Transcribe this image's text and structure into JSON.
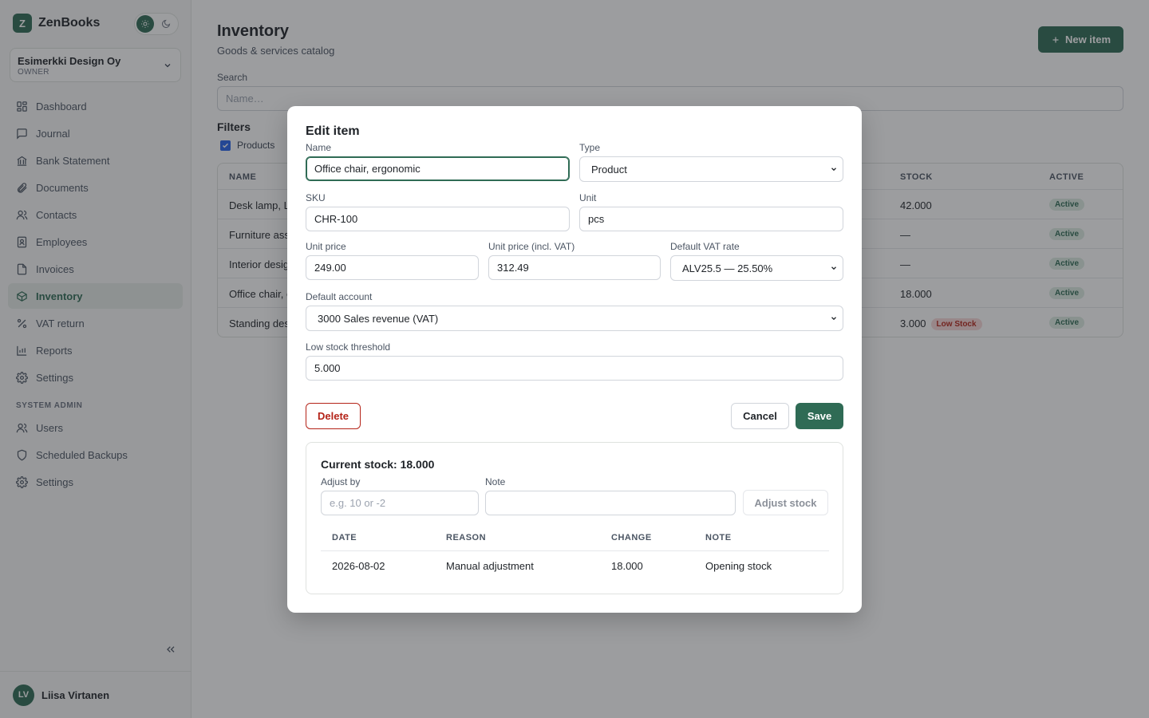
{
  "app": {
    "name": "ZenBooks",
    "logo_letter": "Z"
  },
  "org": {
    "name": "Esimerkki Design Oy",
    "role": "OWNER"
  },
  "nav": {
    "items": [
      {
        "label": "Dashboard",
        "icon": "dashboard-icon",
        "active": false
      },
      {
        "label": "Journal",
        "icon": "journal-icon",
        "active": false
      },
      {
        "label": "Bank Statement",
        "icon": "bank-icon",
        "active": false
      },
      {
        "label": "Documents",
        "icon": "paperclip-icon",
        "active": false
      },
      {
        "label": "Contacts",
        "icon": "contacts-icon",
        "active": false
      },
      {
        "label": "Employees",
        "icon": "employee-badge-icon",
        "active": false
      },
      {
        "label": "Invoices",
        "icon": "invoice-icon",
        "active": false
      },
      {
        "label": "Inventory",
        "icon": "box-icon",
        "active": true
      },
      {
        "label": "VAT return",
        "icon": "percent-icon",
        "active": false
      },
      {
        "label": "Reports",
        "icon": "bar-chart-icon",
        "active": false
      },
      {
        "label": "Settings",
        "icon": "gear-icon",
        "active": false
      }
    ],
    "admin_section": "SYSTEM ADMIN",
    "admin_items": [
      {
        "label": "Users",
        "icon": "users-icon"
      },
      {
        "label": "Scheduled Backups",
        "icon": "shield-icon"
      },
      {
        "label": "Settings",
        "icon": "gear-icon"
      }
    ]
  },
  "user": {
    "initials": "LV",
    "name": "Liisa Virtanen"
  },
  "page": {
    "title": "Inventory",
    "subtitle": "Goods & services catalog",
    "new_button": "New item",
    "search_label": "Search",
    "search_placeholder": "Name…",
    "filters_title": "Filters",
    "filter_products": "Products"
  },
  "table": {
    "headers": {
      "name": "NAME",
      "stock": "STOCK",
      "active": "ACTIVE"
    },
    "rows": [
      {
        "name": "Desk lamp, L",
        "stock": "42.000",
        "low": "",
        "active": "Active"
      },
      {
        "name": "Furniture ass",
        "stock": "—",
        "low": "",
        "active": "Active"
      },
      {
        "name": "Interior desig",
        "stock": "—",
        "low": "",
        "active": "Active"
      },
      {
        "name": "Office chair, e",
        "stock": "18.000",
        "low": "",
        "active": "Active"
      },
      {
        "name": "Standing des",
        "stock": "3.000",
        "low": "Low Stock",
        "active": "Active"
      }
    ]
  },
  "modal": {
    "title": "Edit item",
    "name_label": "Name",
    "name_value": "Office chair, ergonomic",
    "type_label": "Type",
    "type_value": "Product",
    "sku_label": "SKU",
    "sku_value": "CHR-100",
    "unit_label": "Unit",
    "unit_value": "pcs",
    "price_label": "Unit price",
    "price_value": "249.00",
    "price_vat_label": "Unit price (incl. VAT)",
    "price_vat_value": "312.49",
    "vat_label": "Default VAT rate",
    "vat_value": "ALV25.5 — 25.50%",
    "account_label": "Default account",
    "account_value": "3000 Sales revenue (VAT)",
    "threshold_label": "Low stock threshold",
    "threshold_value": "5.000",
    "delete_label": "Delete",
    "cancel_label": "Cancel",
    "save_label": "Save"
  },
  "stock": {
    "title": "Current stock: 18.000",
    "adjust_label": "Adjust by",
    "adjust_placeholder": "e.g. 10 or -2",
    "note_label": "Note",
    "note_value": "",
    "adjust_button": "Adjust stock",
    "headers": {
      "date": "DATE",
      "reason": "REASON",
      "change": "CHANGE",
      "note": "NOTE"
    },
    "movements": [
      {
        "date": "2026-08-02",
        "reason": "Manual adjustment",
        "change": "18.000",
        "note": "Opening stock"
      }
    ]
  },
  "colors": {
    "accent": "#2f6b55",
    "danger": "#b42318",
    "badge_active_bg": "#dcece2",
    "badge_low_bg": "#f8d7d7"
  }
}
